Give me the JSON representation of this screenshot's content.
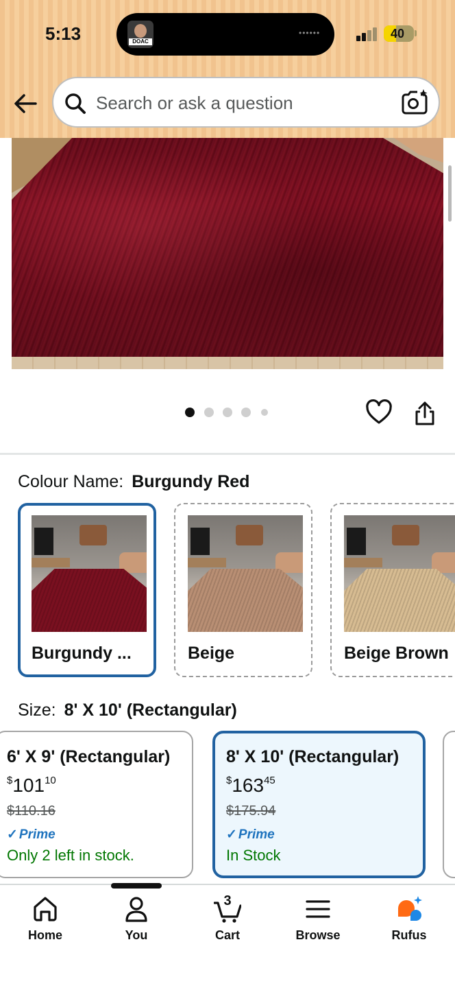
{
  "status_bar": {
    "time": "5:13",
    "island_avatar_label": "DOAC",
    "battery_level": "40",
    "battery_percent": 40
  },
  "header": {
    "search_placeholder": "Search or ask a question",
    "icons": [
      "back-arrow-icon",
      "search-icon",
      "camera-lens-icon"
    ]
  },
  "gallery": {
    "image_count": 5,
    "active_index": 0,
    "icons": [
      "heart-icon",
      "share-icon"
    ]
  },
  "colour": {
    "label": "Colour Name:",
    "selected": "Burgundy Red",
    "options": [
      {
        "name": "Burgundy ...",
        "rug_color": "#7a1020",
        "selected": true
      },
      {
        "name": "Beige",
        "rug_color": "#b98f74",
        "selected": false
      },
      {
        "name": "Beige Brown",
        "rug_color": "#d7bc92",
        "selected": false
      }
    ]
  },
  "size": {
    "label": "Size:",
    "selected": "8' X 10' (Rectangular)",
    "options": [
      {
        "title": "6' X 9' (Rectangular)",
        "currency": "$",
        "price_whole": "101",
        "price_cents": "10",
        "list_price": "$110.16",
        "prime": "Prime",
        "stock": "Only 2 left in stock.",
        "selected": false
      },
      {
        "title": "8' X 10' (Rectangular)",
        "currency": "$",
        "price_whole": "163",
        "price_cents": "45",
        "list_price": "$175.94",
        "prime": "Prime",
        "stock": "In Stock",
        "selected": true
      }
    ]
  },
  "bottom_nav": {
    "items": [
      {
        "label": "Home",
        "icon": "home-icon"
      },
      {
        "label": "You",
        "icon": "person-icon"
      },
      {
        "label": "Cart",
        "icon": "cart-icon",
        "count": "3"
      },
      {
        "label": "Browse",
        "icon": "menu-icon"
      },
      {
        "label": "Rufus",
        "icon": "rufus-icon"
      }
    ]
  },
  "colors": {
    "header_bg": "#f3c894",
    "selected_border": "#2162a1",
    "prime_blue": "#1e73be",
    "stock_green": "#007600",
    "rufus_orange": "#ff6a13",
    "rufus_blue": "#1e88e5"
  }
}
